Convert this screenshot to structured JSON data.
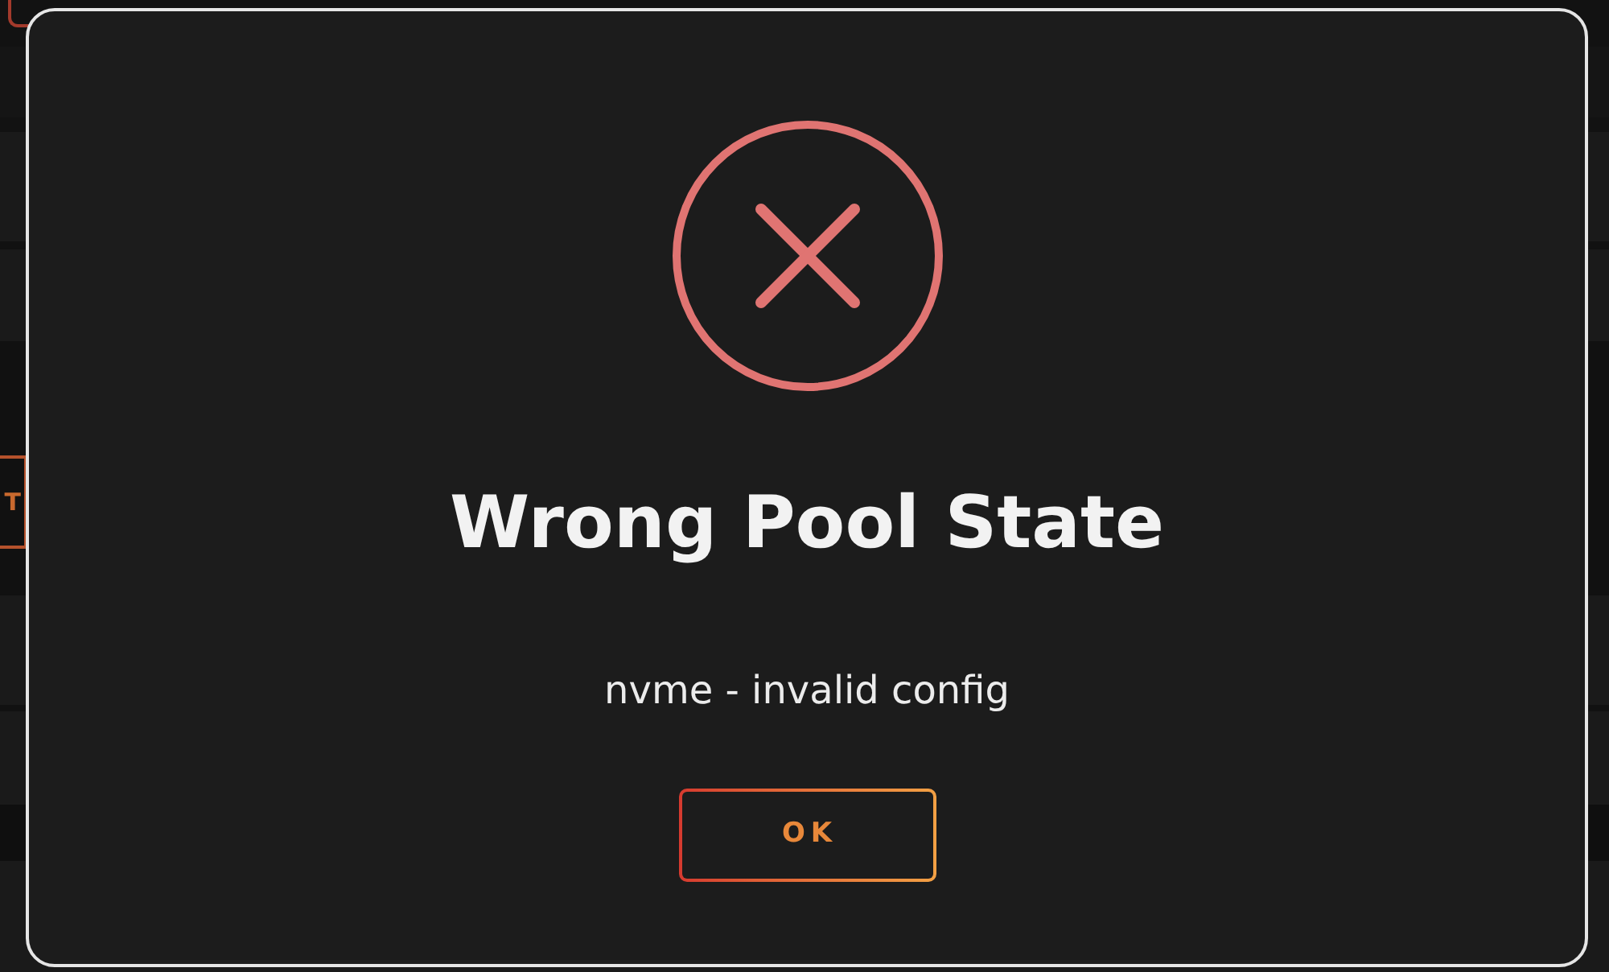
{
  "background": {
    "side_button": {
      "label": "T"
    }
  },
  "dialog": {
    "title": "Wrong Pool State",
    "message": "nvme - invalid config",
    "buttons": [
      {
        "label": "OK"
      }
    ]
  }
}
